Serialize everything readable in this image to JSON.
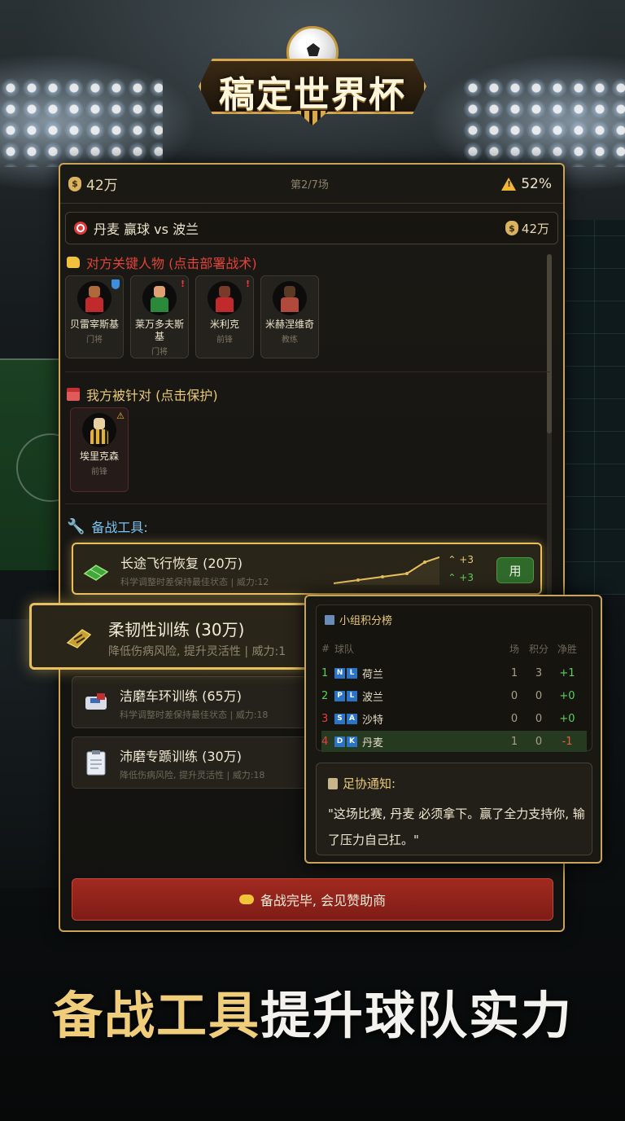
{
  "app": {
    "logo_title": "稿定世界杯"
  },
  "topbar": {
    "money": "42万",
    "round": "第2/7场",
    "risk": "52%"
  },
  "match": {
    "goal": "丹麦 赢球 vs 波兰",
    "reward": "42万"
  },
  "opponents": {
    "title": "对方关键人物 (点击部署战术)",
    "players": [
      {
        "name": "贝雷宰斯基",
        "role": "门将",
        "badge": "shield"
      },
      {
        "name": "莱万多夫斯基",
        "role": "门将",
        "badge": "!"
      },
      {
        "name": "米利克",
        "role": "前锋",
        "badge": "!"
      },
      {
        "name": "米赫涅维奇",
        "role": "教练",
        "badge": ""
      }
    ]
  },
  "ours": {
    "title": "我方被针对 (点击保护)",
    "players": [
      {
        "name": "埃里克森",
        "role": "前锋",
        "badge": "⚠"
      }
    ]
  },
  "tools": {
    "title": "备战工具:",
    "items": [
      {
        "title": "长途飞行恢复 (20万)",
        "desc": "科学调整时差保持最佳状态 | 威力:12",
        "boost1": "+3",
        "boost2": "+3",
        "button": "用"
      },
      {
        "title": "洁磨车环训练 (65万)",
        "desc": "科学调整时差保持最佳状态 | 威力:18"
      },
      {
        "title": "沛磨专踬训练 (30万)",
        "desc": "降低伤病风险, 提升灵活性 | 威力:18"
      }
    ],
    "popout": {
      "title": "柔韧性训练 (30万)",
      "desc": "降低伤病风险, 提升灵活性 | 威力:1"
    }
  },
  "standings": {
    "title": "小组积分榜",
    "headers": {
      "rank": "#",
      "team": "球队",
      "played": "场",
      "points": "积分",
      "gd": "净胜"
    },
    "rows": [
      {
        "rank": "1",
        "code": [
          "N",
          "L"
        ],
        "team": "荷兰",
        "played": "1",
        "points": "3",
        "gd": "+1"
      },
      {
        "rank": "2",
        "code": [
          "P",
          "L"
        ],
        "team": "波兰",
        "played": "0",
        "points": "0",
        "gd": "+0"
      },
      {
        "rank": "3",
        "code": [
          "S",
          "A"
        ],
        "team": "沙特",
        "played": "0",
        "points": "0",
        "gd": "+0"
      },
      {
        "rank": "4",
        "code": [
          "D",
          "K"
        ],
        "team": "丹麦",
        "played": "1",
        "points": "0",
        "gd": "-1"
      }
    ]
  },
  "notice": {
    "title": "足协通知:",
    "body": "\"这场比赛, 丹麦 必须拿下。赢了全力支持你, 输了压力自己扛。\""
  },
  "footer": {
    "sponsor_button": "备战完毕, 会见赞助商"
  },
  "slogan": {
    "gold": "备战工具",
    "white": "提升球队实力"
  },
  "colors": {
    "gold": "#e8c060",
    "danger": "#e0443a",
    "success": "#5ed05a",
    "button_red": "#a22a20"
  }
}
